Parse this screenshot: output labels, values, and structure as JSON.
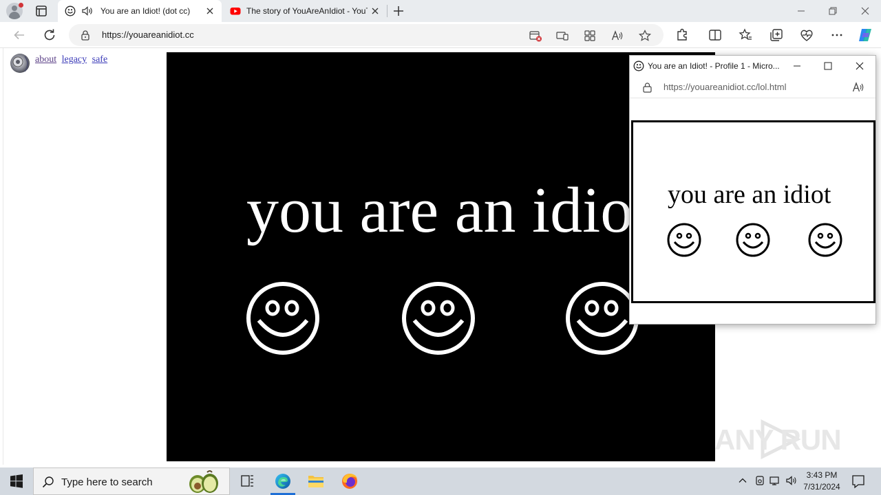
{
  "browser": {
    "tabs": [
      {
        "title": "You are an Idiot! (dot cc)",
        "active": true,
        "audio": true
      },
      {
        "title": "The story of YouAreAnIdiot - YouTube",
        "active": false,
        "audio": false
      }
    ],
    "address_url": "https://youareanidiot.cc"
  },
  "page": {
    "links": [
      {
        "label": "about",
        "visited": true
      },
      {
        "label": "legacy",
        "visited": false
      },
      {
        "label": "safe",
        "visited": false
      }
    ],
    "headline": "you are an idiot",
    "smiley_count": 3
  },
  "popup": {
    "title": "You are an Idiot! - Profile 1 - Micro...",
    "url": "https://youareanidiot.cc/lol.html",
    "text": "you are an idiot",
    "smiley_count": 3
  },
  "watermark": "ANY RUN",
  "taskbar": {
    "search_placeholder": "Type here to search",
    "time": "3:43 PM",
    "date": "7/31/2024"
  },
  "colors": {
    "stage_bg": "#000000",
    "accent": "#1f6fd6",
    "youtube_red": "#ff0000"
  }
}
